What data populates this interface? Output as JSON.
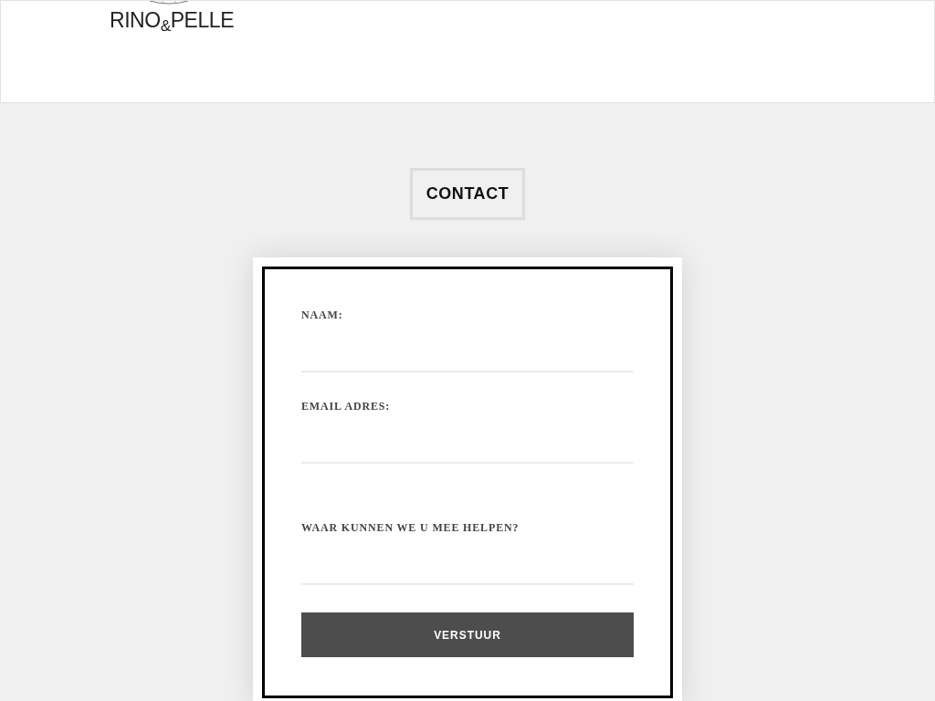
{
  "header": {
    "logo": "RINO$_{&}$PELLE"
  },
  "section_title": "CONTACT",
  "form": {
    "fields": [
      {
        "label": "NAAM:",
        "kind": "text"
      },
      {
        "label": "EMAIL ADRES:",
        "kind": "email"
      },
      {
        "label": "WAAR KUNNEN WE U MEE HELPEN?",
        "kind": "textarea"
      }
    ],
    "submit": "VERSTUUR"
  }
}
